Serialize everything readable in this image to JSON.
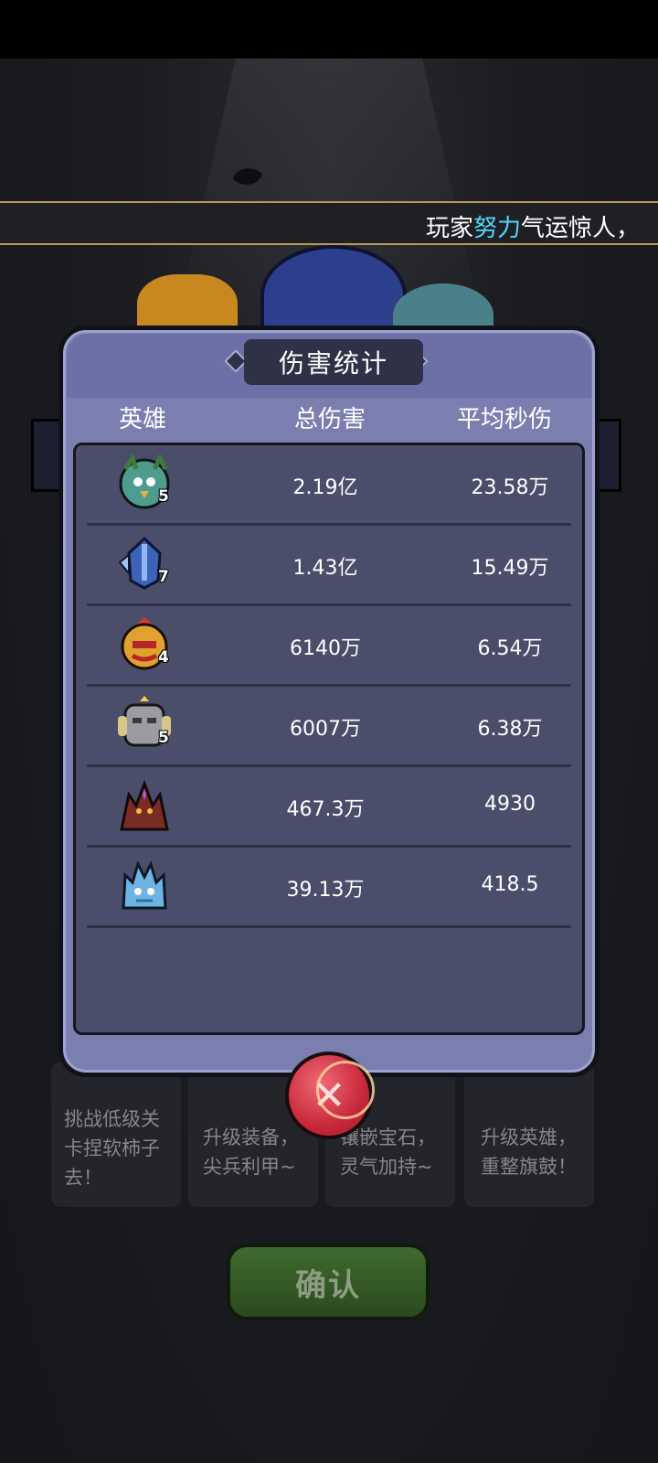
{
  "ticker": {
    "prefix": "玩家",
    "highlight": "努力",
    "suffix": "气运惊人，"
  },
  "background_cards": [
    {
      "text": "挑战低级关卡捏软柿子去！"
    },
    {
      "text": "升级装备，尖兵利甲~"
    },
    {
      "text": "镶嵌宝石，灵气加持~"
    },
    {
      "text": "升级英雄，重整旗鼓！"
    }
  ],
  "confirm_label": "确认",
  "panel": {
    "title": "伤害统计",
    "columns": {
      "hero": "英雄",
      "total": "总伤害",
      "avg": "平均秒伤"
    },
    "rows": [
      {
        "icon": "forest-bird-hero-icon",
        "stars": "5",
        "total": "2.19亿",
        "avg": "23.58万"
      },
      {
        "icon": "blue-knight-hero-icon",
        "stars": "7",
        "total": "1.43亿",
        "avg": "15.49万"
      },
      {
        "icon": "flame-warrior-hero-icon",
        "stars": "4",
        "total": "6140万",
        "avg": "6.54万"
      },
      {
        "icon": "stone-golem-hero-icon",
        "stars": "5",
        "total": "6007万",
        "avg": "6.38万"
      },
      {
        "icon": "shadow-dragon-hero-icon",
        "stars": "",
        "total": "467.3万",
        "avg": "4930"
      },
      {
        "icon": "ice-dragon-hero-icon",
        "stars": "",
        "total": "39.13万",
        "avg": "418.5"
      }
    ]
  },
  "colors": {
    "panel": "#7a7fb0",
    "table": "#4b4e6b",
    "highlight": "#4fd8ff",
    "close": "#c8283a",
    "confirm": "#3f6a2e"
  }
}
